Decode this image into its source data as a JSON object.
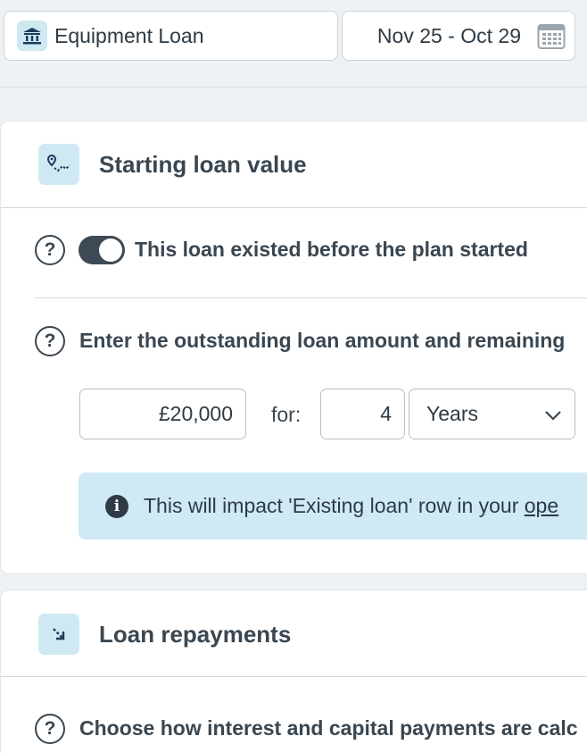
{
  "header": {
    "loan_name": "Equipment Loan",
    "date_range": "Nov 25 - Oct 29",
    "loan_icon": "bank-icon",
    "date_icon": "calendar-icon"
  },
  "starting_section": {
    "title": "Starting loan value",
    "icon": "route-icon",
    "toggle_label": "This loan existed before the plan started",
    "toggle_on": true,
    "amount_prompt": "Enter the outstanding loan amount and remaining",
    "amount_value": "£20,000",
    "for_label": "for:",
    "term_value": "4",
    "term_unit": "Years",
    "info_text": "This will impact 'Existing loan' row in your ",
    "info_link": "ope"
  },
  "repayments_section": {
    "title": "Loan repayments",
    "icon": "arrow-down-right-icon",
    "prompt": "Choose how interest and capital payments are calc"
  },
  "colors": {
    "accent_bg": "#cfe9f3",
    "info_bg": "#cfeaf5",
    "toggle_on": "#3d4a55"
  }
}
